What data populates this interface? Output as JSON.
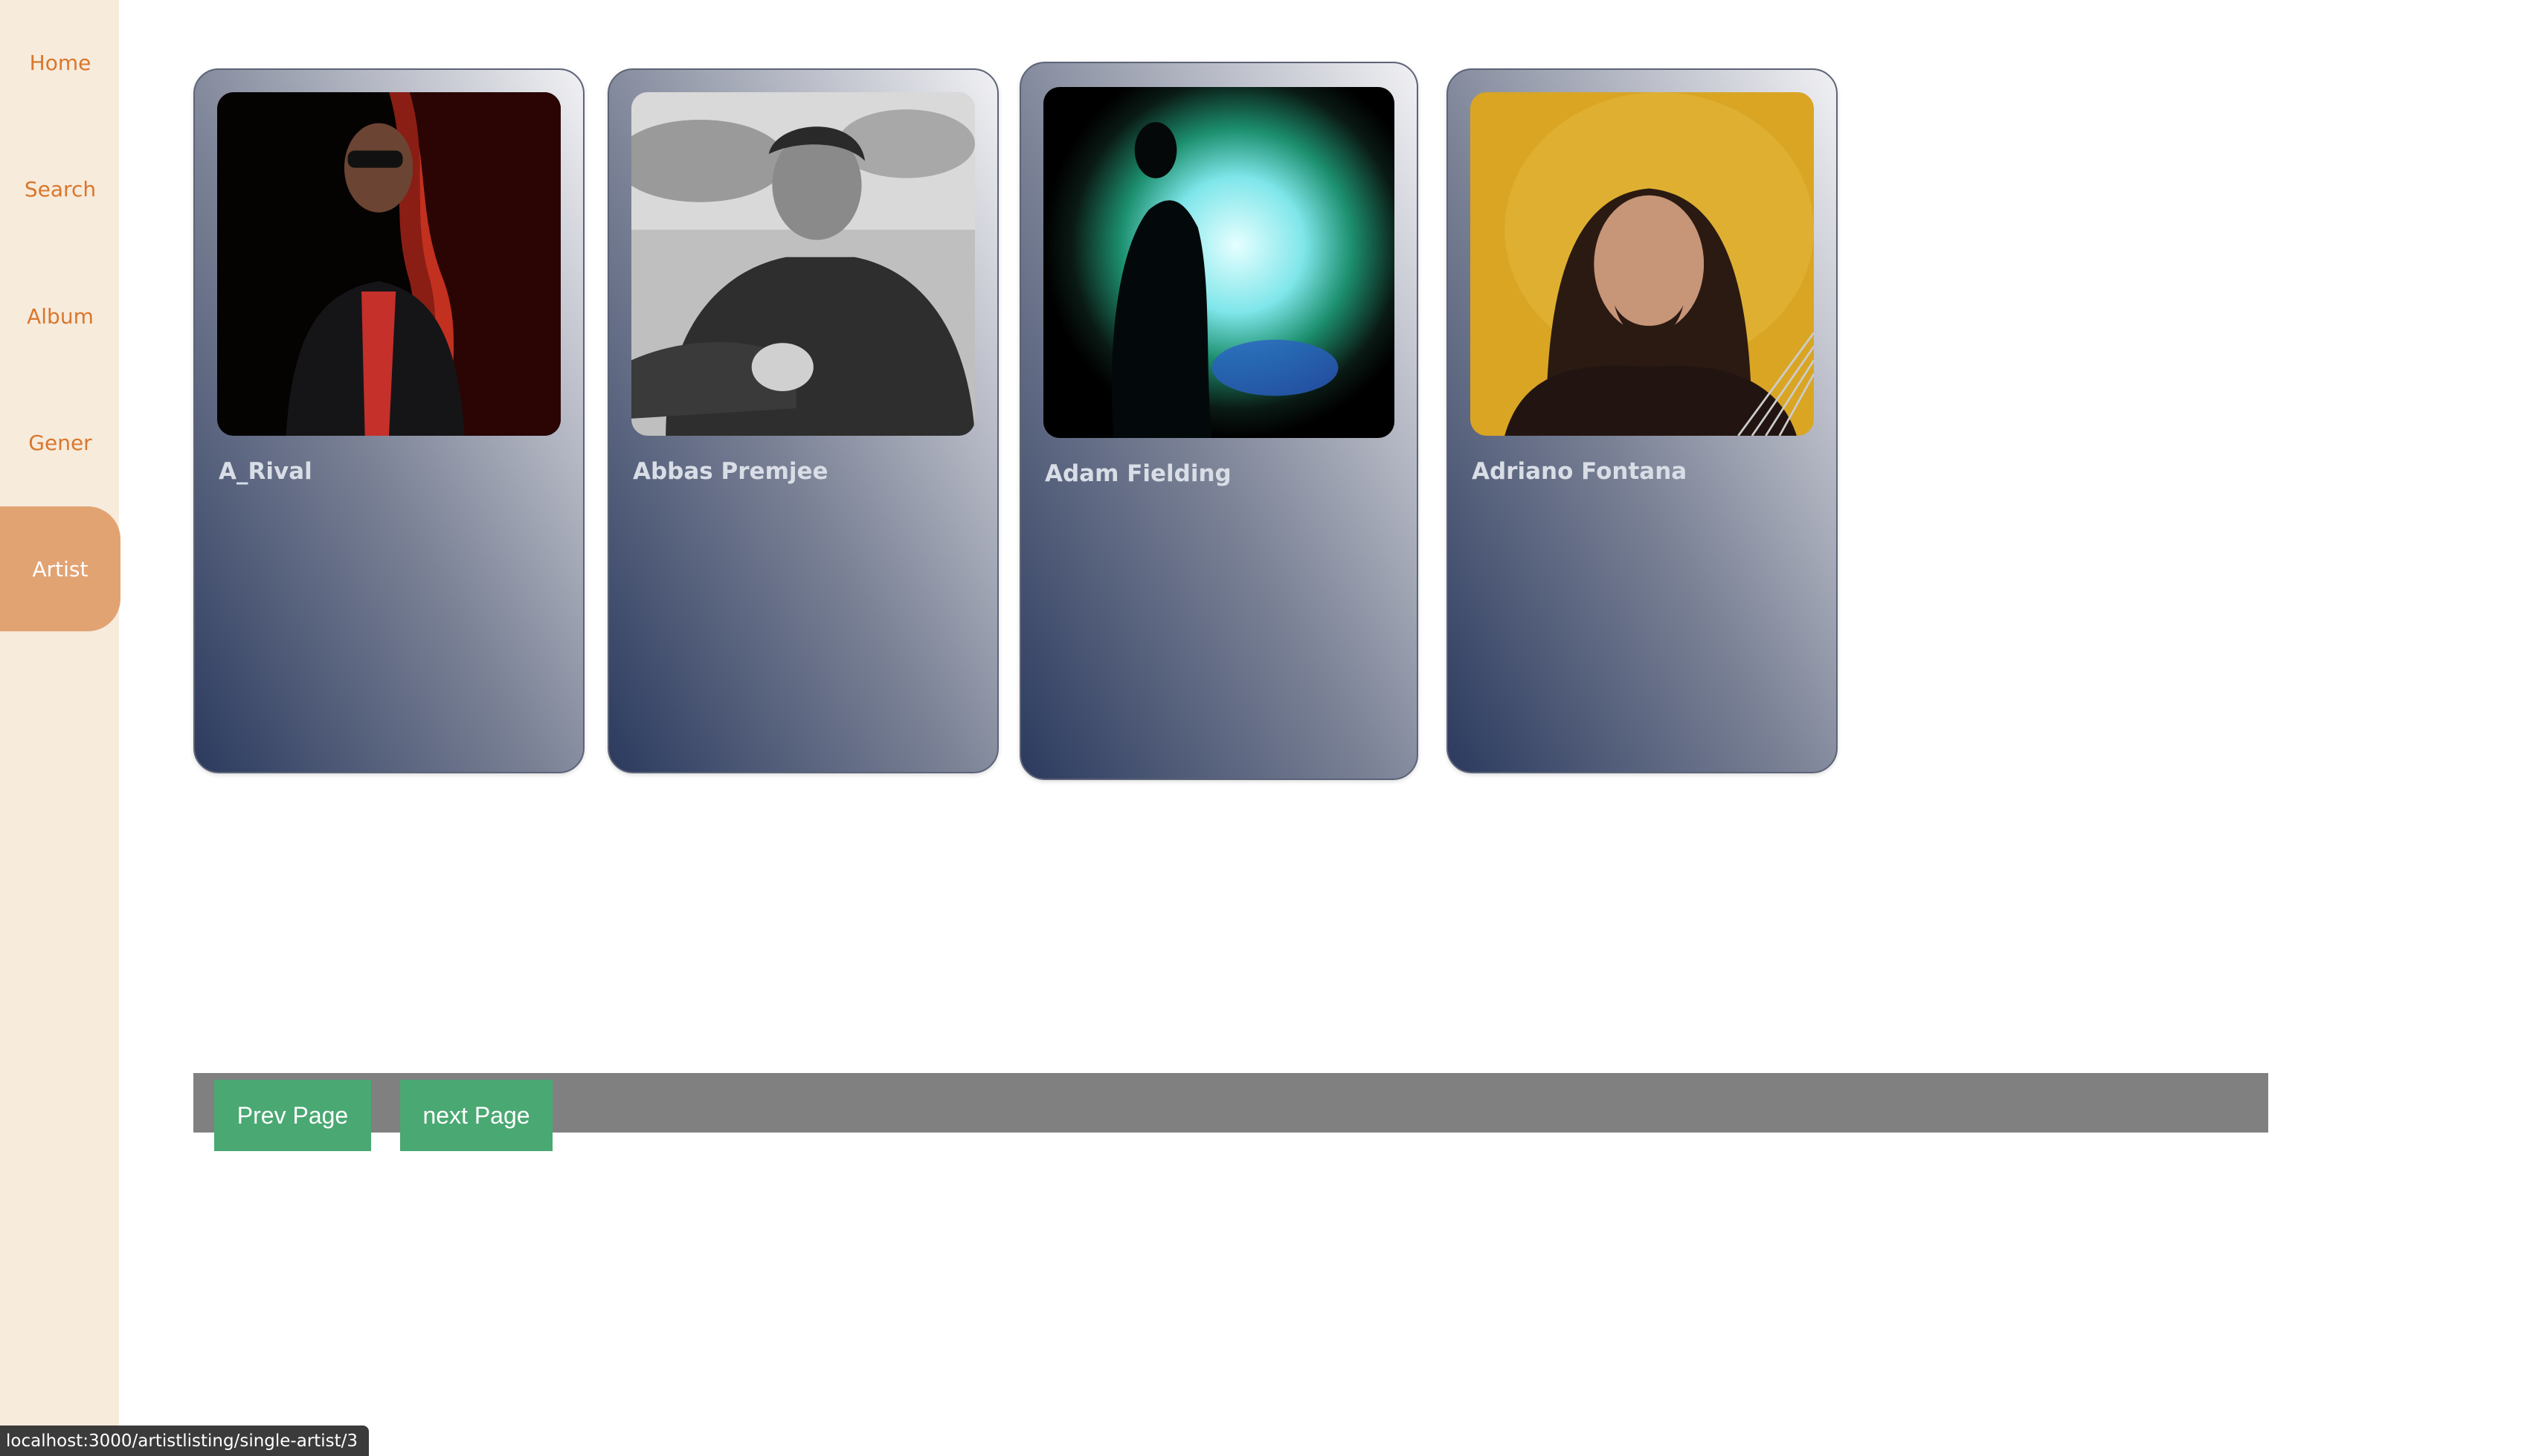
{
  "sidebar": {
    "items": [
      {
        "label": "Home",
        "active": false
      },
      {
        "label": "Search",
        "active": false
      },
      {
        "label": "Album",
        "active": false
      },
      {
        "label": "Gener",
        "active": false
      },
      {
        "label": "Artist",
        "active": true
      }
    ]
  },
  "colors": {
    "sidebar_bg": "#f7ebdc",
    "nav_text": "#d9772c",
    "nav_active_bg": "#e2a373",
    "button_green": "#4aa873",
    "pager_bar": "#808080"
  },
  "artists": [
    {
      "name": "A_Rival",
      "image": "artist-photo-red-portrait"
    },
    {
      "name": "Abbas Premjee",
      "image": "artist-photo-bw-portrait"
    },
    {
      "name": "Adam Fielding",
      "image": "artist-photo-cyan-silhouette"
    },
    {
      "name": "Adriano Fontana",
      "image": "artist-photo-yellow-portrait"
    }
  ],
  "pagination": {
    "prev_label": "Prev Page",
    "next_label": "next Page"
  },
  "status_bar": {
    "url": "localhost:3000/artistlisting/single-artist/3"
  }
}
